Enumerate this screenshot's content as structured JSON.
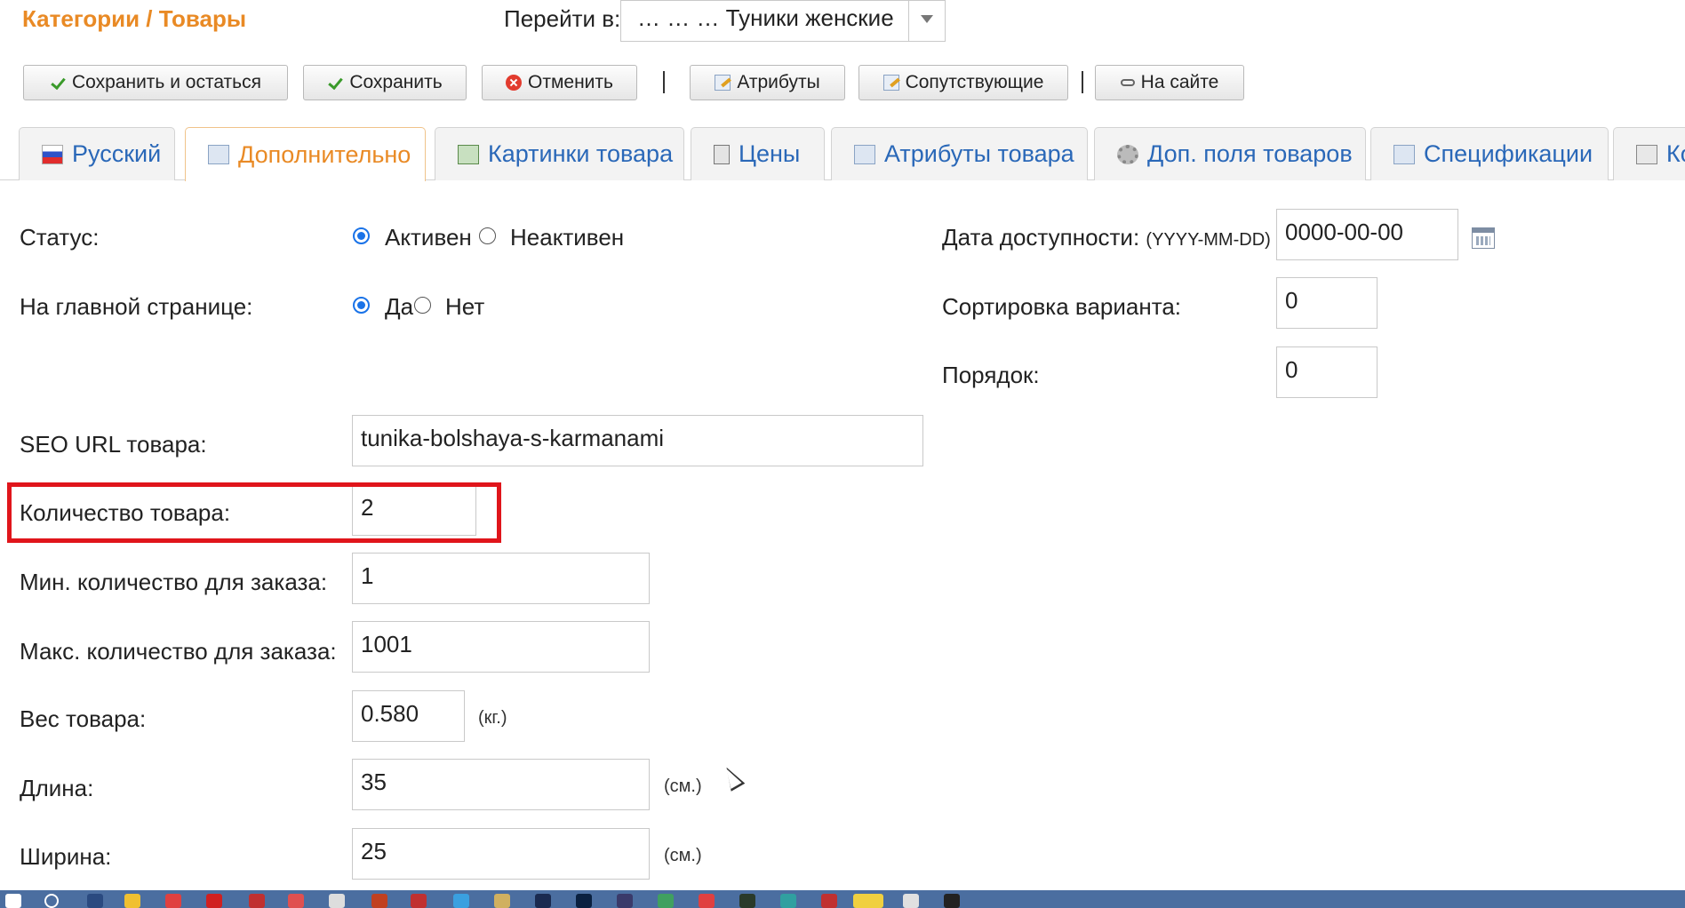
{
  "header": {
    "breadcrumb": "Категории / Товары",
    "goto_label": "Перейти в:",
    "goto_value": "… … … Туники женские"
  },
  "toolbar": {
    "save_stay": "Сохранить и остаться",
    "save": "Сохранить",
    "cancel": "Отменить",
    "attributes": "Атрибуты",
    "related": "Сопутствующие",
    "on_site": "На сайте"
  },
  "tabs": [
    {
      "label": "Русский",
      "icon": "russia-flag-icon"
    },
    {
      "label": "Дополнительно",
      "icon": "edit-icon"
    },
    {
      "label": "Картинки товара",
      "icon": "image-icon"
    },
    {
      "label": "Цены",
      "icon": "calculator-icon"
    },
    {
      "label": "Атрибуты товара",
      "icon": "table-icon"
    },
    {
      "label": "Доп. поля товаров",
      "icon": "gear-icon"
    },
    {
      "label": "Спецификации",
      "icon": "spec-icon"
    },
    {
      "label": "Ко",
      "icon": "basket-icon"
    }
  ],
  "active_tab": "Дополнительно",
  "form": {
    "status_label": "Статус:",
    "status_active": "Активен",
    "status_inactive": "Неактивен",
    "status_value": "Активен",
    "main_page_label": "На главной странице:",
    "main_page_yes": "Да",
    "main_page_no": "Нет",
    "main_page_value": "Да",
    "seo_label": "SEO URL товара:",
    "seo_value": "tunika-bolshaya-s-karmanami",
    "qty_label": "Количество товара:",
    "qty_value": "2",
    "min_label": "Мин. количество для заказа:",
    "min_value": "1",
    "max_label": "Макс. количество для заказа:",
    "max_value": "1001",
    "weight_label": "Вес товара:",
    "weight_value": "0.580",
    "weight_unit": "(кг.)",
    "length_label": "Длина:",
    "length_value": "35",
    "length_unit": "(см.)",
    "width_label": "Ширина:",
    "width_value": "25",
    "width_unit": "(см.)",
    "date_label": "Дата доступности:",
    "date_format": "(YYYY-MM-DD)",
    "date_value": "0000-00-00",
    "variant_sort_label": "Сортировка варианта:",
    "variant_sort_value": "0",
    "order_label": "Порядок:",
    "order_value": "0"
  },
  "colors": {
    "accent": "#e98a25",
    "link": "#2a68b8",
    "highlight": "#e0151b",
    "radio": "#1a73e8"
  }
}
